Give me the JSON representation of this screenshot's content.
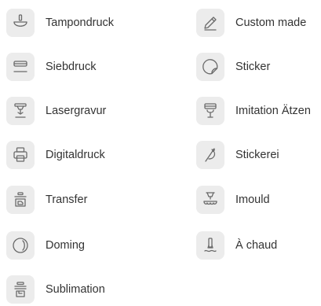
{
  "techniques": {
    "left": [
      {
        "label": "Tampondruck",
        "icon": "tampon-print-icon"
      },
      {
        "label": "Siebdruck",
        "icon": "screen-print-icon"
      },
      {
        "label": "Lasergravur",
        "icon": "laser-engraving-icon"
      },
      {
        "label": "Digitaldruck",
        "icon": "digital-print-icon"
      },
      {
        "label": "Transfer",
        "icon": "transfer-icon"
      },
      {
        "label": "Doming",
        "icon": "doming-icon"
      },
      {
        "label": "Sublimation",
        "icon": "sublimation-icon"
      }
    ],
    "right": [
      {
        "label": "Custom made",
        "icon": "pencil-icon"
      },
      {
        "label": "Sticker",
        "icon": "sticker-icon"
      },
      {
        "label": "Imitation Ätzen",
        "icon": "etching-icon"
      },
      {
        "label": "Stickerei",
        "icon": "embroidery-needle-icon"
      },
      {
        "label": "Imould",
        "icon": "imould-icon"
      },
      {
        "label": "À chaud",
        "icon": "hot-stamping-icon"
      }
    ]
  },
  "colors": {
    "icon_background": "#ececec",
    "icon_stroke": "#6a6a6a",
    "text": "#333333"
  }
}
